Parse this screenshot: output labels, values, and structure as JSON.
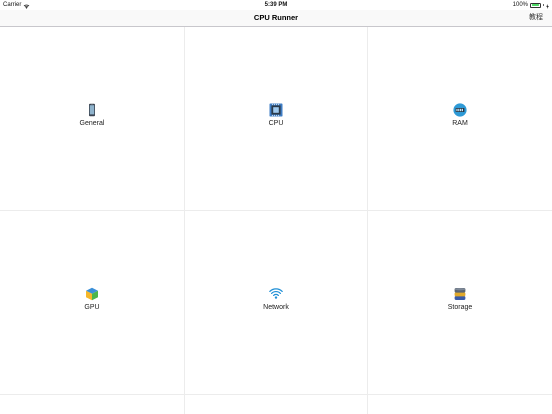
{
  "status_bar": {
    "carrier": "Carrier",
    "time": "5:39 PM",
    "battery": "100%",
    "battery_level": 1.0
  },
  "nav_bar": {
    "title": "CPU Runner",
    "right_button": "教程"
  },
  "tiles": [
    {
      "label": "General",
      "icon": "phone-icon"
    },
    {
      "label": "CPU",
      "icon": "cpu-chip-icon"
    },
    {
      "label": "RAM",
      "icon": "ram-icon"
    },
    {
      "label": "GPU",
      "icon": "gpu-cube-icon"
    },
    {
      "label": "Network",
      "icon": "wifi-icon"
    },
    {
      "label": "Storage",
      "icon": "database-icon"
    }
  ],
  "colors": {
    "battery_fill": "#4cd964",
    "grid_line": "#ececec",
    "nav_background": "#f9f9f9"
  }
}
